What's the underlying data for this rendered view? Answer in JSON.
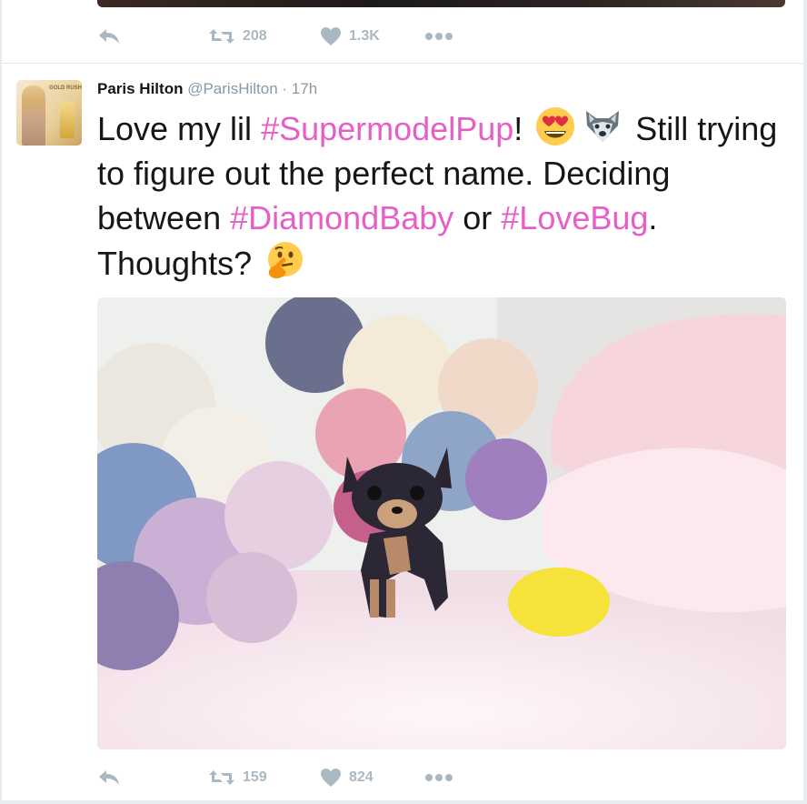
{
  "previous_tweet": {
    "actions": {
      "retweets": "208",
      "likes": "1.3K"
    }
  },
  "tweet": {
    "author_name": "Paris Hilton",
    "handle": "@ParisHilton",
    "separator": "·",
    "time": "17h",
    "avatar_text": "GOLD RUSH",
    "text": {
      "t1": "Love my lil ",
      "tag1": "#SupermodelPup",
      "t2": "! ",
      "t3": " Still trying to figure out the perfect name. Deciding between ",
      "tag2": "#DiamondBaby",
      "t4": " or ",
      "tag3": "#LoveBug",
      "t5": ". Thoughts? "
    },
    "emojis": [
      "heart-eyes-emoji",
      "wolf-emoji",
      "thinking-face-emoji"
    ],
    "actions": {
      "retweets": "159",
      "likes": "824"
    }
  },
  "colors": {
    "hashtag": "#e55fc7",
    "action_gray": "#aab8c2",
    "meta_gray": "#8899a6"
  }
}
